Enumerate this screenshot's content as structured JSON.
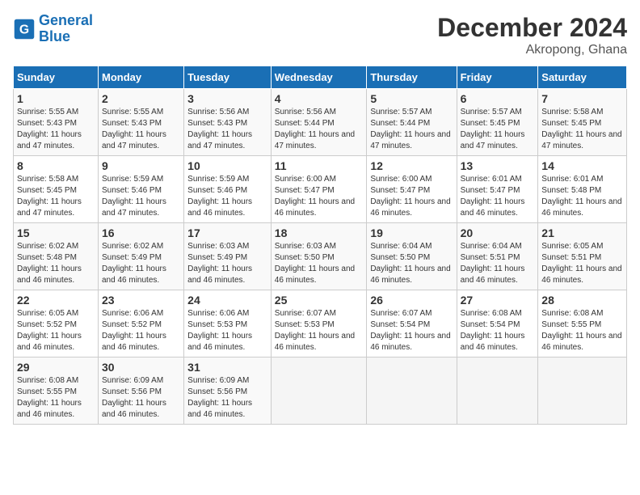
{
  "logo": {
    "line1": "General",
    "line2": "Blue"
  },
  "title": "December 2024",
  "subtitle": "Akropong, Ghana",
  "days_header": [
    "Sunday",
    "Monday",
    "Tuesday",
    "Wednesday",
    "Thursday",
    "Friday",
    "Saturday"
  ],
  "weeks": [
    [
      {
        "num": "1",
        "sunrise": "5:55 AM",
        "sunset": "5:43 PM",
        "daylight": "11 hours and 47 minutes."
      },
      {
        "num": "2",
        "sunrise": "5:55 AM",
        "sunset": "5:43 PM",
        "daylight": "11 hours and 47 minutes."
      },
      {
        "num": "3",
        "sunrise": "5:56 AM",
        "sunset": "5:43 PM",
        "daylight": "11 hours and 47 minutes."
      },
      {
        "num": "4",
        "sunrise": "5:56 AM",
        "sunset": "5:44 PM",
        "daylight": "11 hours and 47 minutes."
      },
      {
        "num": "5",
        "sunrise": "5:57 AM",
        "sunset": "5:44 PM",
        "daylight": "11 hours and 47 minutes."
      },
      {
        "num": "6",
        "sunrise": "5:57 AM",
        "sunset": "5:45 PM",
        "daylight": "11 hours and 47 minutes."
      },
      {
        "num": "7",
        "sunrise": "5:58 AM",
        "sunset": "5:45 PM",
        "daylight": "11 hours and 47 minutes."
      }
    ],
    [
      {
        "num": "8",
        "sunrise": "5:58 AM",
        "sunset": "5:45 PM",
        "daylight": "11 hours and 47 minutes."
      },
      {
        "num": "9",
        "sunrise": "5:59 AM",
        "sunset": "5:46 PM",
        "daylight": "11 hours and 47 minutes."
      },
      {
        "num": "10",
        "sunrise": "5:59 AM",
        "sunset": "5:46 PM",
        "daylight": "11 hours and 46 minutes."
      },
      {
        "num": "11",
        "sunrise": "6:00 AM",
        "sunset": "5:47 PM",
        "daylight": "11 hours and 46 minutes."
      },
      {
        "num": "12",
        "sunrise": "6:00 AM",
        "sunset": "5:47 PM",
        "daylight": "11 hours and 46 minutes."
      },
      {
        "num": "13",
        "sunrise": "6:01 AM",
        "sunset": "5:47 PM",
        "daylight": "11 hours and 46 minutes."
      },
      {
        "num": "14",
        "sunrise": "6:01 AM",
        "sunset": "5:48 PM",
        "daylight": "11 hours and 46 minutes."
      }
    ],
    [
      {
        "num": "15",
        "sunrise": "6:02 AM",
        "sunset": "5:48 PM",
        "daylight": "11 hours and 46 minutes."
      },
      {
        "num": "16",
        "sunrise": "6:02 AM",
        "sunset": "5:49 PM",
        "daylight": "11 hours and 46 minutes."
      },
      {
        "num": "17",
        "sunrise": "6:03 AM",
        "sunset": "5:49 PM",
        "daylight": "11 hours and 46 minutes."
      },
      {
        "num": "18",
        "sunrise": "6:03 AM",
        "sunset": "5:50 PM",
        "daylight": "11 hours and 46 minutes."
      },
      {
        "num": "19",
        "sunrise": "6:04 AM",
        "sunset": "5:50 PM",
        "daylight": "11 hours and 46 minutes."
      },
      {
        "num": "20",
        "sunrise": "6:04 AM",
        "sunset": "5:51 PM",
        "daylight": "11 hours and 46 minutes."
      },
      {
        "num": "21",
        "sunrise": "6:05 AM",
        "sunset": "5:51 PM",
        "daylight": "11 hours and 46 minutes."
      }
    ],
    [
      {
        "num": "22",
        "sunrise": "6:05 AM",
        "sunset": "5:52 PM",
        "daylight": "11 hours and 46 minutes."
      },
      {
        "num": "23",
        "sunrise": "6:06 AM",
        "sunset": "5:52 PM",
        "daylight": "11 hours and 46 minutes."
      },
      {
        "num": "24",
        "sunrise": "6:06 AM",
        "sunset": "5:53 PM",
        "daylight": "11 hours and 46 minutes."
      },
      {
        "num": "25",
        "sunrise": "6:07 AM",
        "sunset": "5:53 PM",
        "daylight": "11 hours and 46 minutes."
      },
      {
        "num": "26",
        "sunrise": "6:07 AM",
        "sunset": "5:54 PM",
        "daylight": "11 hours and 46 minutes."
      },
      {
        "num": "27",
        "sunrise": "6:08 AM",
        "sunset": "5:54 PM",
        "daylight": "11 hours and 46 minutes."
      },
      {
        "num": "28",
        "sunrise": "6:08 AM",
        "sunset": "5:55 PM",
        "daylight": "11 hours and 46 minutes."
      }
    ],
    [
      {
        "num": "29",
        "sunrise": "6:08 AM",
        "sunset": "5:55 PM",
        "daylight": "11 hours and 46 minutes."
      },
      {
        "num": "30",
        "sunrise": "6:09 AM",
        "sunset": "5:56 PM",
        "daylight": "11 hours and 46 minutes."
      },
      {
        "num": "31",
        "sunrise": "6:09 AM",
        "sunset": "5:56 PM",
        "daylight": "11 hours and 46 minutes."
      },
      null,
      null,
      null,
      null
    ]
  ]
}
